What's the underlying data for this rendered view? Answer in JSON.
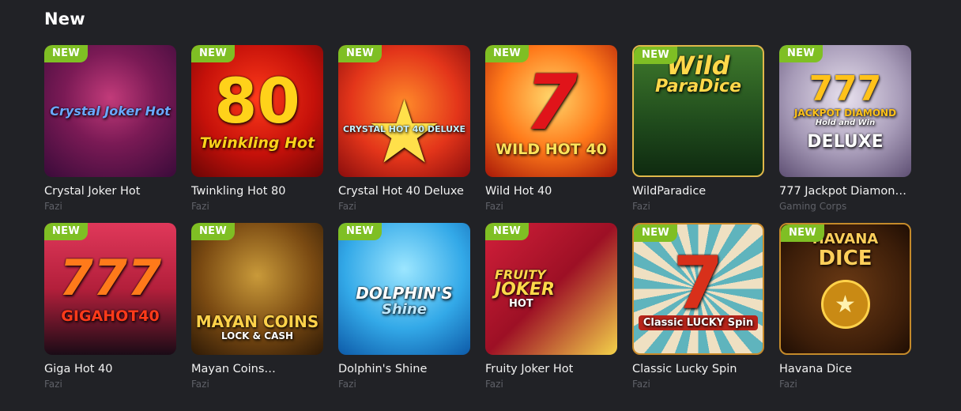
{
  "section": {
    "title": "New"
  },
  "badge_label": "NEW",
  "games": [
    {
      "title": "Crystal Joker Hot",
      "provider": "Fazi",
      "art_text": "Crystal Joker Hot",
      "art_color": "#6aa8ff"
    },
    {
      "title": "Twinkling Hot 80",
      "provider": "Fazi",
      "art_text": "80",
      "art_sub": "Twinkling Hot",
      "art_color": "#ffd21a"
    },
    {
      "title": "Crystal Hot 40 Deluxe",
      "provider": "Fazi",
      "art_text": "★",
      "art_sub": "CRYSTAL HOT 40 DELUXE",
      "art_color": "#ffe04a"
    },
    {
      "title": "Wild Hot 40",
      "provider": "Fazi",
      "art_text": "7",
      "art_sub": "WILD HOT 40",
      "art_color": "#e0141a"
    },
    {
      "title": "WildParadice",
      "provider": "Fazi",
      "art_text": "Wild",
      "art_sub": "ParaDice",
      "art_color": "#ffd84a"
    },
    {
      "title": "777 Jackpot Diamon…",
      "provider": "Gaming Corps",
      "art_text": "777",
      "art_sub": "JACKPOT DIAMOND",
      "art_extra": "Hold and Win",
      "art_extra2": "DELUXE",
      "art_color": "#ffc21a"
    },
    {
      "title": "Giga Hot 40",
      "provider": "Fazi",
      "art_text": "777",
      "art_sub": "GIGAHOT40",
      "art_color": "#ff7a1a"
    },
    {
      "title": "Mayan Coins…",
      "provider": "Fazi",
      "art_text": "MAYAN COINS",
      "art_sub": "LOCK & CASH",
      "art_color": "#ffd24a"
    },
    {
      "title": "Dolphin's Shine",
      "provider": "Fazi",
      "art_text": "DOLPHIN'S",
      "art_sub": "Shine",
      "art_color": "#ffffff"
    },
    {
      "title": "Fruity Joker Hot",
      "provider": "Fazi",
      "art_text": "FRUITY",
      "art_sub": "JOKER",
      "art_extra": "HOT",
      "art_color": "#ffd84a"
    },
    {
      "title": "Classic Lucky Spin",
      "provider": "Fazi",
      "art_text": "7",
      "art_sub": "Classic LUCKY Spin",
      "art_color": "#d8301a"
    },
    {
      "title": "Havana Dice",
      "provider": "Fazi",
      "art_text": "HAVANA",
      "art_sub": "DICE",
      "art_color": "#ffcf5a"
    }
  ]
}
